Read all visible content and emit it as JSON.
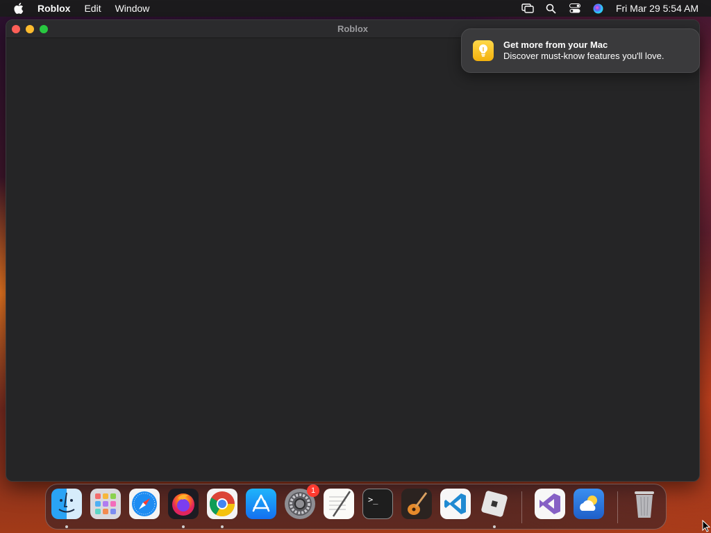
{
  "menubar": {
    "app_name": "Roblox",
    "items": [
      "Edit",
      "Window"
    ],
    "clock": "Fri Mar 29  5:54 AM",
    "status_icons": [
      "screen-mirroring-icon",
      "spotlight-search-icon",
      "control-center-icon",
      "siri-icon"
    ]
  },
  "window": {
    "title": "Roblox"
  },
  "notification": {
    "app": "Tips",
    "title": "Get more from your Mac",
    "body": "Discover must-know features you'll love."
  },
  "dock": {
    "items": [
      {
        "name": "Finder",
        "icon": "finder-icon",
        "running": true
      },
      {
        "name": "Launchpad",
        "icon": "launchpad-icon",
        "running": false
      },
      {
        "name": "Safari",
        "icon": "safari-icon",
        "running": false
      },
      {
        "name": "Firefox",
        "icon": "firefox-icon",
        "running": true
      },
      {
        "name": "Google Chrome",
        "icon": "chrome-icon",
        "running": true
      },
      {
        "name": "App Store",
        "icon": "app-store-icon",
        "running": false
      },
      {
        "name": "System Settings",
        "icon": "system-settings-icon",
        "running": false,
        "badge": "1"
      },
      {
        "name": "TextEdit",
        "icon": "textedit-icon",
        "running": false
      },
      {
        "name": "Terminal",
        "icon": "terminal-icon",
        "running": false
      },
      {
        "name": "GarageBand",
        "icon": "garageband-icon",
        "running": false
      },
      {
        "name": "Visual Studio Code",
        "icon": "vscode-icon",
        "running": false
      },
      {
        "name": "Roblox",
        "icon": "roblox-icon",
        "running": true
      },
      {
        "name": "Visual Studio",
        "icon": "visual-studio-icon",
        "running": false
      },
      {
        "name": "Weather",
        "icon": "weather-icon",
        "running": false
      },
      {
        "name": "Trash",
        "icon": "trash-icon",
        "running": false
      }
    ]
  }
}
